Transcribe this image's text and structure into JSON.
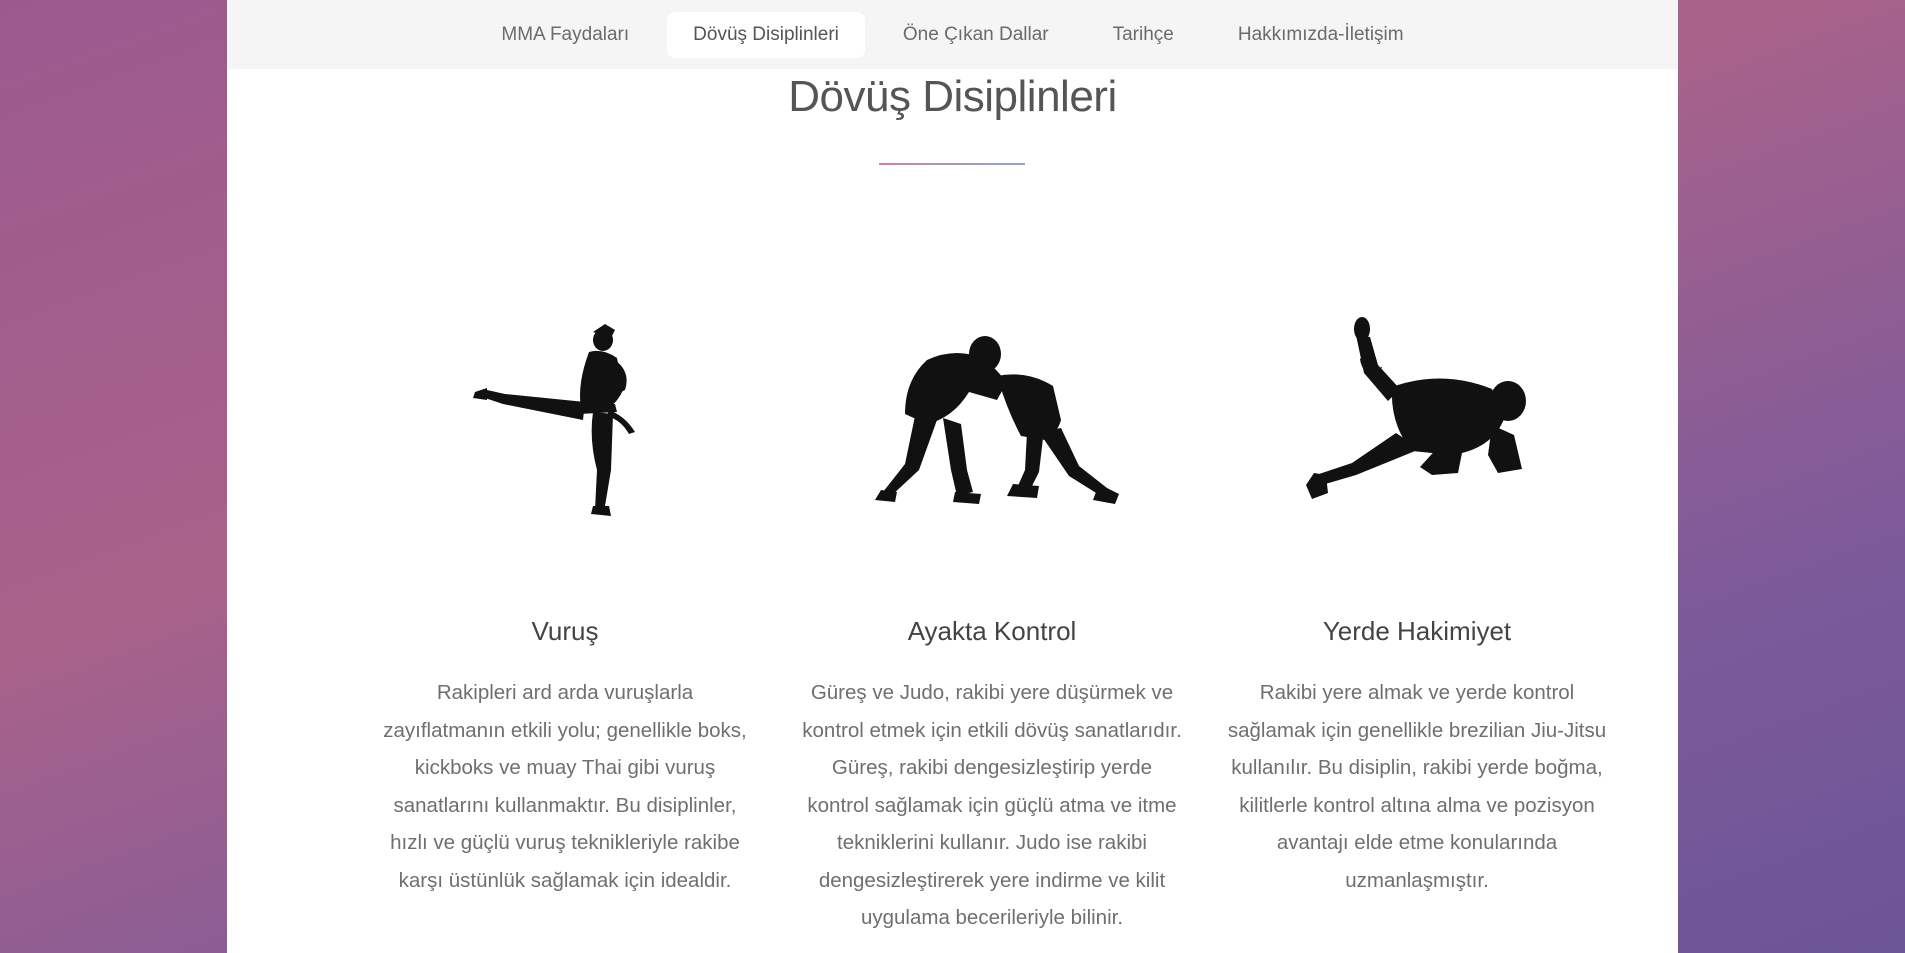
{
  "nav": {
    "items": [
      {
        "label": "MMA Faydaları"
      },
      {
        "label": "Dövüş Disiplinleri",
        "active": true
      },
      {
        "label": "Öne Çıkan Dallar"
      },
      {
        "label": "Tarihçe"
      },
      {
        "label": "Hakkımızda-İletişim"
      }
    ]
  },
  "section": {
    "title": "Dövüş Disiplinleri"
  },
  "columns": [
    {
      "icon": "karate-kick-icon",
      "heading": "Vuruş",
      "text": "Rakipleri ard arda vuruşlarla zayıflatmanın etkili yolu; genellikle boks, kickboks ve muay Thai gibi vuruş sanatlarını kullanmaktır. Bu disiplinler, hızlı ve güçlü vuruş teknikleriyle rakibe karşı üstünlük sağlamak için idealdir."
    },
    {
      "icon": "wrestlers-icon",
      "heading": "Ayakta Kontrol",
      "text": "Güreş ve Judo, rakibi yere düşürmek ve kontrol etmek için etkili dövüş sanatlarıdır. Güreş, rakibi dengesizleştirip yerde kontrol sağlamak için güçlü atma ve itme tekniklerini kullanır. Judo ise rakibi dengesizleştirerek yere indirme ve kilit uygulama becerileriyle bilinir."
    },
    {
      "icon": "ground-fighter-icon",
      "heading": "Yerde Hakimiyet",
      "text": "Rakibi yere almak ve yerde kontrol sağlamak için genellikle brezilian Jiu-Jitsu kullanılır. Bu disiplin, rakibi yerde boğma, kilitlerle kontrol altına alma ve pozisyon avantajı elde etme konularında uzmanlaşmıştır."
    }
  ]
}
